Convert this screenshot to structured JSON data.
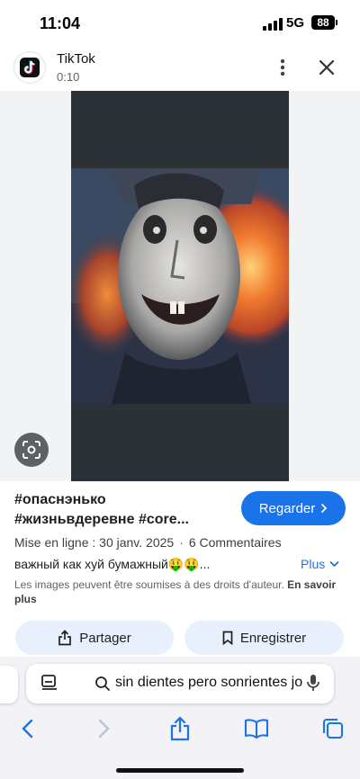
{
  "status_bar": {
    "time": "11:04",
    "network": "5G",
    "battery": "88"
  },
  "header": {
    "app_name": "TikTok",
    "subtitle": "0:10"
  },
  "content": {
    "title_line1": "#опаснэнько",
    "title_line2": "#жизньвдеревне #core...",
    "watch_label": "Regarder",
    "upload_date": "Mise en ligne : 30 janv. 2025",
    "comments": "6 Commentaires",
    "description": "важный как хуй бумажный🤑🤑...",
    "more_label": "Plus",
    "copyright_text": "Les images peuvent être soumises à des droits d'auteur.",
    "learn_more": "En savoir plus",
    "share_label": "Partager",
    "save_label": "Enregistrer"
  },
  "browser": {
    "search_text": "sin dientes pero sonrientes jo"
  },
  "colors": {
    "accent": "#1a73e8",
    "pill_bg": "#e8f0fe",
    "frame_bg": "#2b3135"
  },
  "icons": [
    "tiktok-logo-icon",
    "more-vert-icon",
    "close-icon",
    "lens-icon",
    "chevron-right-icon",
    "chevron-down-icon",
    "share-icon",
    "bookmark-icon",
    "tabs-list-icon",
    "search-icon",
    "mic-icon",
    "back-icon",
    "forward-icon",
    "share-ios-icon",
    "book-icon",
    "tabs-icon"
  ]
}
